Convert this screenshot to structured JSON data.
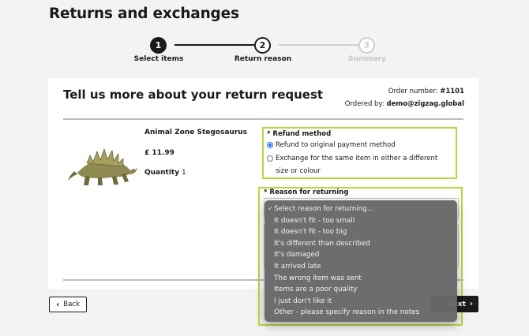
{
  "page": {
    "title": "Returns and exchanges"
  },
  "stepper": {
    "steps": [
      {
        "number": "1",
        "label": "Select items",
        "state": "complete"
      },
      {
        "number": "2",
        "label": "Return reason",
        "state": "current"
      },
      {
        "number": "3",
        "label": "Summary",
        "state": "upcoming"
      }
    ]
  },
  "card": {
    "title": "Tell us more about your return request",
    "order_number_label": "Order number:",
    "order_number": "#1101",
    "ordered_by_label": "Ordered by:",
    "ordered_by": "demo@zigzag.global"
  },
  "product": {
    "name": "Animal Zone Stegosaurus",
    "price": "£ 11.99",
    "quantity_label": "Quantity",
    "quantity": "1"
  },
  "refund": {
    "label": "* Refund method",
    "options": [
      {
        "label": "Refund to original payment method",
        "selected": true
      },
      {
        "label": "Exchange for the same item in either a different size or colour",
        "selected": false
      }
    ]
  },
  "reason": {
    "label": "* Reason for returning",
    "selected": "Select reason for returning...",
    "options": [
      "Select reason for returning...",
      "It doesn't fit - too small",
      "It doesn't fit - too big",
      "It's different than described",
      "It's damaged",
      "It arrived late",
      "The wrong item was sent",
      "Items are a poor quality",
      "I just don't like it",
      "Other - please specify reason in the notes"
    ]
  },
  "nav": {
    "back_label": "Back",
    "next_label": "Next"
  },
  "colors": {
    "highlight": "#b9d83a",
    "dark": "#1a1a1a",
    "dropdown_bg": "#686868"
  }
}
